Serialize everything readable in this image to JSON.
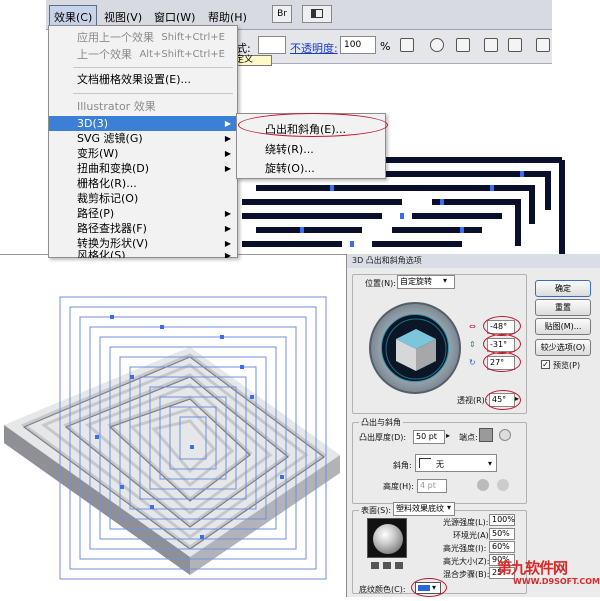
{
  "menubar": {
    "effect": "效果(C)",
    "view": "视图(V)",
    "window": "窗口(W)",
    "help": "帮助(H)",
    "bridge_badge": "Br"
  },
  "controlbar": {
    "style_label": "式:",
    "opacity_label": "不透明度:",
    "opacity_value": "100",
    "opacity_unit": "%",
    "define_tooltip": "定义"
  },
  "effect_menu": {
    "apply_last": "应用上一个效果",
    "apply_last_shortcut": "Shift+Ctrl+E",
    "last_effect": "上一个效果",
    "last_effect_shortcut": "Alt+Shift+Ctrl+E",
    "doc_raster": "文档栅格效果设置(E)...",
    "section_illustrator": "Illustrator 效果",
    "items": [
      {
        "label": "3D(3)",
        "has_submenu": true
      },
      {
        "label": "SVG 滤镜(G)",
        "has_submenu": true
      },
      {
        "label": "变形(W)",
        "has_submenu": true
      },
      {
        "label": "扭曲和变换(D)",
        "has_submenu": true
      },
      {
        "label": "栅格化(R)...",
        "has_submenu": false
      },
      {
        "label": "裁剪标记(O)",
        "has_submenu": false
      },
      {
        "label": "路径(P)",
        "has_submenu": true
      },
      {
        "label": "路径查找器(F)",
        "has_submenu": true
      },
      {
        "label": "转换为形状(V)",
        "has_submenu": true
      },
      {
        "label": "风格化(S)",
        "has_submenu": true
      }
    ]
  },
  "submenu_3d": {
    "extrude_bevel": "凸出和斜角(E)...",
    "revolve": "绕转(R)...",
    "rotate": "旋转(O)..."
  },
  "dialog": {
    "title": "3D 凸出和斜角选项",
    "position_label": "位置(N):",
    "position_value": "自定旋转",
    "rot_x": "-48°",
    "rot_y": "-31°",
    "rot_z": "27°",
    "perspective_label": "透视(R):",
    "perspective_value": "45°",
    "ok": "确定",
    "reset": "重置",
    "map": "贴图(M)...",
    "fewer_options": "较少选项(O)",
    "preview": "预览(P)",
    "preview_checked": true,
    "extrude_section": "凸出与斜角",
    "extrude_depth_label": "凸出厚度(D):",
    "extrude_depth_value": "50 pt",
    "cap_label": "端点:",
    "bevel_label": "斜角:",
    "bevel_value": "无",
    "height_label": "高度(H):",
    "height_value": "4 pt",
    "surface_label": "表面(S):",
    "surface_value": "塑料效果底纹",
    "light_intensity_label": "光源强度(L):",
    "light_intensity_value": "100%",
    "ambient_label": "环境光(A):",
    "ambient_value": "50%",
    "highlight_intensity_label": "高光强度(I):",
    "highlight_intensity_value": "60%",
    "highlight_size_label": "高光大小(Z):",
    "highlight_size_value": "90%",
    "blend_steps_label": "混合步骤(B):",
    "blend_steps_value": "25",
    "shading_color_label": "底纹颜色(C):"
  },
  "watermark": {
    "brand": "第九软件网",
    "url": "WWW.D9SOFT.COM"
  },
  "colors": {
    "menu_highlight": "#3c7fd6",
    "annotation_red": "#c0182a",
    "maze_stroke": "#0a0f2c",
    "maze_wall": "#d9dbdd",
    "selection_blue": "#3d6cf0"
  }
}
